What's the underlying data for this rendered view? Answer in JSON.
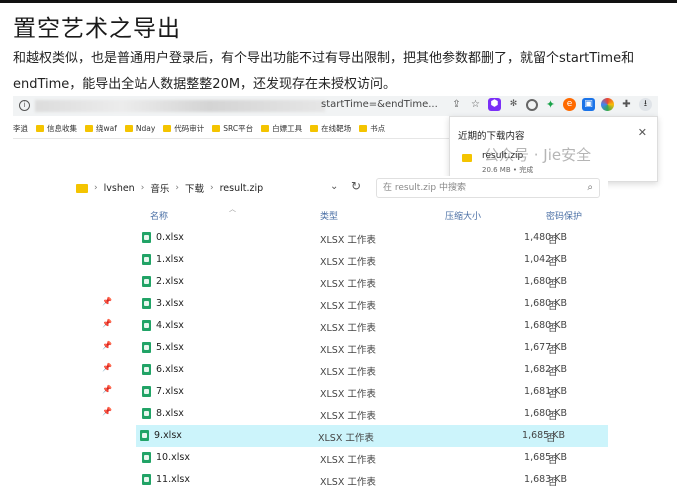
{
  "article": {
    "title": "置空艺术之导出",
    "para1": "和越权类似，也是普通用户登录后，有个导出功能不过有导出限制，把其他参数都删了，就留个startTime和",
    "para2": "endTime，能导出全站人数据整整20M，还发现存在未授权访问。"
  },
  "browser": {
    "url_tail": "startTime=&endTime...",
    "bookmarks": [
      "李逍",
      "信息收集",
      "绕waf",
      "Nday",
      "代码审计",
      "SRC平台",
      "白嫖工具",
      "在线靶场",
      "书点"
    ],
    "toolbar_icons": [
      "share-icon",
      "star-icon",
      "ext-purple-icon",
      "ext-gear-icon",
      "ext-circle-icon",
      "ext-green-icon",
      "ext-orange-icon",
      "ext-blue-icon",
      "ext-color-icon",
      "puzzle-icon",
      "download-icon"
    ]
  },
  "download_popup": {
    "title": "近期的下载内容",
    "close": "✕",
    "file": "result.zip",
    "meta": "20.6 MB • 完成"
  },
  "watermark": "公众号 · Jie安全",
  "explorer": {
    "breadcrumb": [
      "lvshen",
      "音乐",
      "下载",
      "result.zip"
    ],
    "search_placeholder": "在 result.zip 中搜索",
    "columns": {
      "name": "名称",
      "type": "类型",
      "size": "压缩大小",
      "password": "密码保护"
    },
    "files": [
      {
        "name": "0.xlsx",
        "type": "XLSX 工作表",
        "size": "1,480 KB",
        "pw": "否"
      },
      {
        "name": "1.xlsx",
        "type": "XLSX 工作表",
        "size": "1,042 KB",
        "pw": "否"
      },
      {
        "name": "2.xlsx",
        "type": "XLSX 工作表",
        "size": "1,680 KB",
        "pw": "否"
      },
      {
        "name": "3.xlsx",
        "type": "XLSX 工作表",
        "size": "1,680 KB",
        "pw": "否"
      },
      {
        "name": "4.xlsx",
        "type": "XLSX 工作表",
        "size": "1,680 KB",
        "pw": "否"
      },
      {
        "name": "5.xlsx",
        "type": "XLSX 工作表",
        "size": "1,677 KB",
        "pw": "否"
      },
      {
        "name": "6.xlsx",
        "type": "XLSX 工作表",
        "size": "1,682 KB",
        "pw": "否"
      },
      {
        "name": "7.xlsx",
        "type": "XLSX 工作表",
        "size": "1,681 KB",
        "pw": "否"
      },
      {
        "name": "8.xlsx",
        "type": "XLSX 工作表",
        "size": "1,680 KB",
        "pw": "否"
      },
      {
        "name": "9.xlsx",
        "type": "XLSX 工作表",
        "size": "1,685 KB",
        "pw": "否"
      },
      {
        "name": "10.xlsx",
        "type": "XLSX 工作表",
        "size": "1,685 KB",
        "pw": "否"
      },
      {
        "name": "11.xlsx",
        "type": "XLSX 工作表",
        "size": "1,683 KB",
        "pw": "否"
      }
    ]
  },
  "colors": {
    "selected_row": "#ccf4fb",
    "excel_green": "#21a366",
    "folder_yellow": "#f4c400",
    "header_blue": "#4a6fa5"
  }
}
